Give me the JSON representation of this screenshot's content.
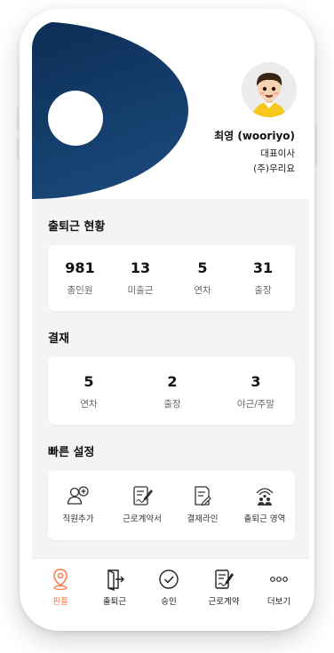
{
  "profile": {
    "name": "최영 (wooriyo)",
    "role": "대표이사",
    "company": "(주)우리요"
  },
  "attendance": {
    "title": "출퇴근 현황",
    "stats": [
      {
        "value": "981",
        "label": "총인원"
      },
      {
        "value": "13",
        "label": "미출근"
      },
      {
        "value": "5",
        "label": "연차"
      },
      {
        "value": "31",
        "label": "출장"
      }
    ]
  },
  "approval": {
    "title": "결재",
    "stats": [
      {
        "value": "5",
        "label": "연차"
      },
      {
        "value": "2",
        "label": "출장"
      },
      {
        "value": "3",
        "label": "야근/주말"
      }
    ]
  },
  "quick_settings": {
    "title": "빠른 설정",
    "items": [
      {
        "label": "직원추가",
        "icon": "add-user-icon"
      },
      {
        "label": "근로계약서",
        "icon": "contract-icon"
      },
      {
        "label": "결재라인",
        "icon": "document-edit-icon"
      },
      {
        "label": "출퇴근 영역",
        "icon": "geofence-icon"
      }
    ]
  },
  "tabbar": {
    "items": [
      {
        "label": "핀플",
        "icon": "location-pin-icon",
        "active": true
      },
      {
        "label": "출퇴근",
        "icon": "door-exit-icon",
        "active": false
      },
      {
        "label": "승인",
        "icon": "check-circle-icon",
        "active": false
      },
      {
        "label": "근로계약",
        "icon": "contract-icon",
        "active": false
      },
      {
        "label": "더보기",
        "icon": "more-dots-icon",
        "active": false
      }
    ]
  },
  "colors": {
    "brand_navy": "#0c2d55",
    "accent_orange": "#ff7a45",
    "background": "#f4f4f6"
  }
}
